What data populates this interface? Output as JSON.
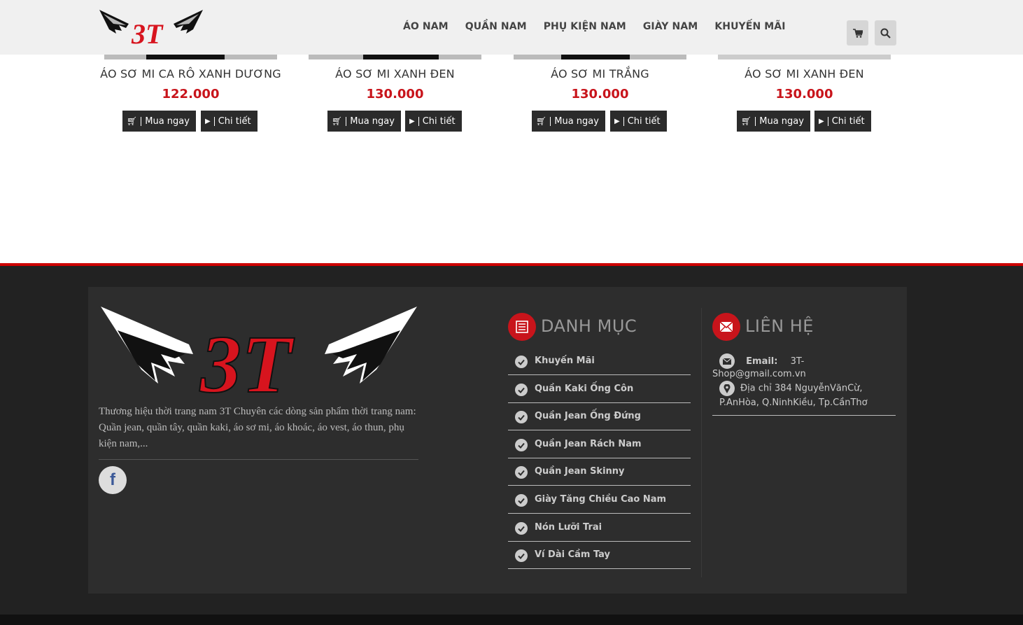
{
  "header": {
    "nav": [
      "ÁO NAM",
      "QUẦN NAM",
      "PHỤ KIỆN NAM",
      "GIÀY NAM",
      "KHUYẾN MÃI"
    ],
    "logo_text": "3T"
  },
  "products": [
    {
      "name": "ÁO SƠ MI CA RÔ XANH DƯƠNG",
      "price": "122.000",
      "buy": "Mua ngay",
      "detail": "Chi tiết"
    },
    {
      "name": "ÁO SƠ MI XANH ĐEN",
      "price": "130.000",
      "buy": "Mua ngay",
      "detail": "Chi tiết"
    },
    {
      "name": "ÁO SƠ MI TRẮNG",
      "price": "130.000",
      "buy": "Mua ngay",
      "detail": "Chi tiết"
    },
    {
      "name": "ÁO SƠ MI XANH ĐEN",
      "price": "130.000",
      "buy": "Mua ngay",
      "detail": "Chi tiết"
    }
  ],
  "footer": {
    "logo_text": "3T",
    "description": "Thương hiệu thời trang nam 3T Chuyên các dòng sản phẩm thời trang nam: Quần jean, quần tây, quần kaki, áo sơ mi, áo khoác, áo vest, áo thun, phụ kiện nam,...",
    "categories_title": "DANH MỤC",
    "categories": [
      "Khuyến Mãi",
      "Quần Kaki Ống Côn",
      "Quần Jean Ống Đứng",
      "Quần Jean Rách Nam",
      "Quần Jean Skinny",
      "Giày Tăng Chiều Cao Nam",
      "Nón Lưỡi Trai",
      "Ví Dài Cầm Tay"
    ],
    "contact_title": "LIÊN HỆ",
    "email_label": "Email:",
    "email_value": "3T-Shop@gmail.com.vn",
    "address": "Địa chỉ 384 NguyễnVănCừ, P.AnHòa, Q.NinhKiều, Tp.CầnThơ"
  },
  "colors": {
    "accent": "#c8141b",
    "footer_bg": "#222222",
    "panel_bg": "#2d2d2d",
    "header_bg": "#f0f0f0"
  }
}
